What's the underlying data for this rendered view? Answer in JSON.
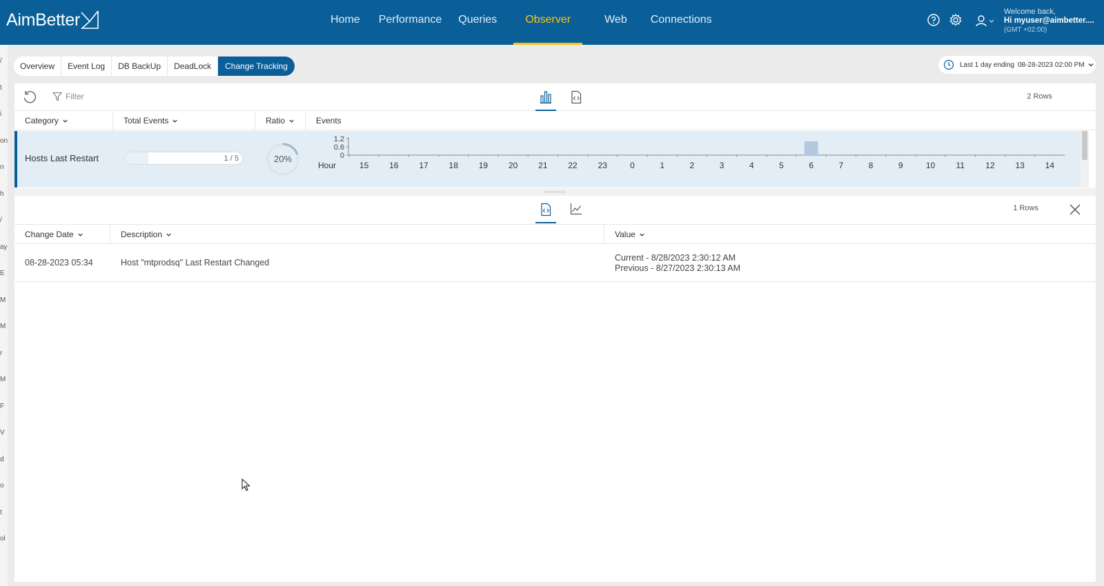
{
  "app": {
    "logo": "AimBetter",
    "nav": [
      "Home",
      "Performance",
      "Queries",
      "Observer",
      "Web",
      "Connections"
    ],
    "active_nav": "Observer",
    "user": {
      "welcome": "Welcome back,",
      "name": "Hi myuser@aimbetter....",
      "timezone": "(GMT +02:00)"
    },
    "colors": {
      "topbar": "#0a5f99",
      "accent": "#ffc20e"
    }
  },
  "left_rail": [
    "/",
    "t",
    "i",
    "on",
    "n",
    "h",
    "/",
    "ay",
    "E",
    "M",
    "M",
    "r",
    "M",
    "F",
    "V",
    "d",
    "o",
    "t",
    "ol"
  ],
  "tabs": [
    "Overview",
    "Event Log",
    "DB BackUp",
    "DeadLock",
    "Change Tracking"
  ],
  "active_tab": "Change Tracking",
  "time_range": {
    "label": "Last 1 day ending",
    "value": "08-28-2023 02:00 PM"
  },
  "summary_panel": {
    "filter_placeholder": "Filter",
    "rows_count": "2 Rows",
    "columns": [
      "Category",
      "Total Events",
      "Ratio",
      "Events"
    ],
    "rows": [
      {
        "category": "Hosts Last Restart",
        "total_events_text": "1 / 5",
        "total_events_fraction": 0.2,
        "ratio_text": "20%",
        "ratio": 0.2
      }
    ]
  },
  "chart_data": {
    "type": "bar",
    "xlabel": "Hour",
    "categories": [
      "15",
      "16",
      "17",
      "18",
      "19",
      "20",
      "21",
      "22",
      "23",
      "0",
      "1",
      "2",
      "3",
      "4",
      "5",
      "6",
      "7",
      "8",
      "9",
      "10",
      "11",
      "12",
      "13",
      "14"
    ],
    "values": [
      0,
      0,
      0,
      0,
      0,
      0,
      0,
      0,
      0,
      0,
      0,
      0,
      0,
      0,
      0,
      1,
      0,
      0,
      0,
      0,
      0,
      0,
      0,
      0
    ],
    "yticks": [
      "1.2",
      "0.6",
      "0"
    ],
    "ylim": [
      0,
      1.2
    ],
    "bar_color": "#b3c9e0"
  },
  "detail_panel": {
    "rows_count": "1 Rows",
    "columns": [
      "Change Date",
      "Description",
      "Value"
    ],
    "rows": [
      {
        "change_date": "08-28-2023 05:34",
        "description": "Host \"mtprodsq\" Last Restart Changed",
        "value_current": "Current - 8/28/2023 2:30:12 AM",
        "value_previous": "Previous - 8/27/2023 2:30:13 AM"
      }
    ]
  }
}
